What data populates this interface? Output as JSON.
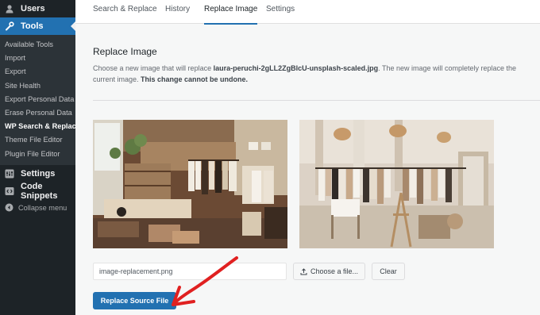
{
  "sidebar": {
    "users_label": "Users",
    "tools_label": "Tools",
    "tools_submenu": [
      "Available Tools",
      "Import",
      "Export",
      "Site Health",
      "Export Personal Data",
      "Erase Personal Data",
      "WP Search & Replace",
      "Theme File Editor",
      "Plugin File Editor"
    ],
    "settings_label": "Settings",
    "snippets_label": "Code Snippets",
    "collapse_label": "Collapse menu"
  },
  "tabs": [
    "Search & Replace",
    "History",
    "Replace Image",
    "Settings"
  ],
  "active_tab": "Replace Image",
  "section": {
    "title": "Replace Image",
    "desc_prefix": "Choose a new image that will replace ",
    "filename": "laura-peruchi-2gLL2ZgBlcU-unsplash-scaled.jpg",
    "desc_middle": ". The new image will completely replace the current image. ",
    "warning": "This change cannot be undone."
  },
  "form": {
    "file_value": "image-replacement.png",
    "choose_label": "Choose a file...",
    "clear_label": "Clear",
    "submit_label": "Replace Source File"
  },
  "colors": {
    "accent": "#2271b1",
    "sidebar_bg": "#1d2327",
    "annotation_arrow": "#e02020"
  }
}
